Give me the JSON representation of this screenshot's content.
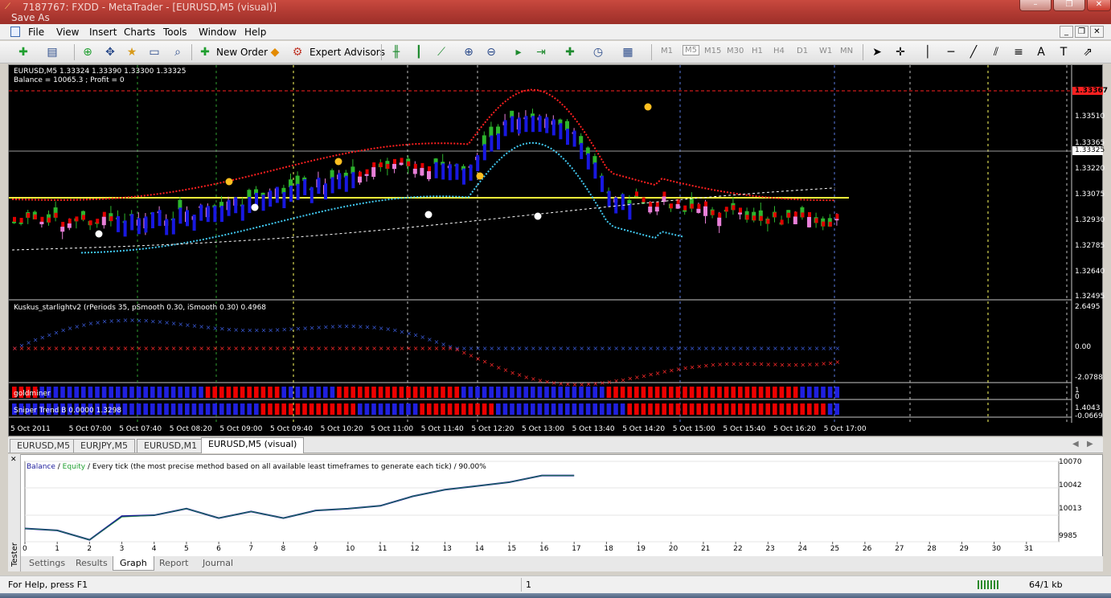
{
  "window": {
    "title": "7187767: FXDD - MetaTrader - [EURUSD,M5 (visual)]",
    "overlay_title": "Save As"
  },
  "menu": [
    "File",
    "View",
    "Insert",
    "Charts",
    "Tools",
    "Window",
    "Help"
  ],
  "toolbar": {
    "new_order": "New Order",
    "expert_advisors": "Expert Advisors",
    "timeframes": [
      "M1",
      "M5",
      "M15",
      "M30",
      "H1",
      "H4",
      "D1",
      "W1",
      "MN"
    ],
    "active_timeframe": "M5"
  },
  "chart": {
    "header_line1": "EURUSD,M5  1.33324 1.33390 1.33300 1.33325",
    "header_line2": "Balance = 10065.3 ; Profit = 0",
    "price_labels": [
      "1.33367",
      "1.33510",
      "1.33365",
      "1.33325",
      "1.33220",
      "1.33075",
      "1.32930",
      "1.32785",
      "1.32640",
      "1.32495"
    ],
    "indicator1": {
      "label": "Kuskus_starlightv2  (rPeriods 35, pSmooth 0.30, iSmooth 0.30)   0.4968",
      "scale": [
        "2.6495",
        "0.00",
        "-2.0788"
      ]
    },
    "indicator2": {
      "label": "goldminer",
      "scale": [
        "1",
        "0"
      ]
    },
    "indicator3": {
      "label": "Sniper Trend B 0.0000 1.3298",
      "scale": [
        "1.4043",
        "-0.0669"
      ]
    },
    "time_labels": [
      "5 Oct 2011",
      "5 Oct 07:00",
      "5 Oct 07:40",
      "5 Oct 08:20",
      "5 Oct 09:00",
      "5 Oct 09:40",
      "5 Oct 10:20",
      "5 Oct 11:00",
      "5 Oct 11:40",
      "5 Oct 12:20",
      "5 Oct 13:00",
      "5 Oct 13:40",
      "5 Oct 14:20",
      "5 Oct 15:00",
      "5 Oct 15:40",
      "5 Oct 16:20",
      "5 Oct 17:00"
    ],
    "colors": {
      "bull": "#2db52d",
      "bear": "#e87fd8",
      "ma_fast_up": "#1818e0",
      "ma_fast_down": "#e00000",
      "ma_slow": "#40c8f0",
      "level": "#ffff3a",
      "stop": "#ff2020"
    }
  },
  "chart_tabs": [
    "EURUSD,M5",
    "EURJPY,M5",
    "EURUSD,M1",
    "EURUSD,M5 (visual)"
  ],
  "active_chart_tab": "EURUSD,M5 (visual)",
  "tester": {
    "side_label": "Tester",
    "legend_balance": "Balance",
    "legend_sep": " / ",
    "legend_equity": "Equity",
    "legend_rest": " / Every tick (the most precise method based on all available least timeframes to generate each tick) / 90.00%",
    "y_labels": [
      "10070",
      "10042",
      "10013",
      "9985"
    ],
    "x_labels": [
      "0",
      "1",
      "2",
      "3",
      "4",
      "5",
      "6",
      "7",
      "8",
      "9",
      "10",
      "11",
      "12",
      "13",
      "14",
      "15",
      "16",
      "17",
      "18",
      "19",
      "20",
      "21",
      "22",
      "23",
      "24",
      "25",
      "26",
      "27",
      "28",
      "29",
      "30",
      "31"
    ],
    "tabs": [
      "Settings",
      "Results",
      "Graph",
      "Report",
      "Journal"
    ],
    "active_tab": "Graph"
  },
  "chart_data": {
    "type": "line",
    "x": [
      0,
      1,
      2,
      3,
      4,
      5,
      6,
      7,
      8,
      9,
      10,
      11,
      12,
      13,
      14,
      15,
      16,
      17
    ],
    "ylim": [
      9985,
      10070
    ],
    "series": [
      {
        "name": "Balance",
        "values": [
          9999,
          9997,
          9987,
          10012,
          10013,
          10020,
          10010,
          10017,
          10010,
          10018,
          10020,
          10023,
          10033,
          10040,
          10044,
          10048,
          10055,
          10055
        ]
      },
      {
        "name": "Equity",
        "values": [
          9999,
          9997,
          9987,
          10011,
          10013,
          10020,
          10010,
          10017,
          10010,
          10018,
          10020,
          10023,
          10033,
          10040,
          10044,
          10048,
          10055,
          10055
        ]
      }
    ]
  },
  "status": {
    "help": "For Help, press F1",
    "profile": "1",
    "traffic": "64/1 kb"
  }
}
